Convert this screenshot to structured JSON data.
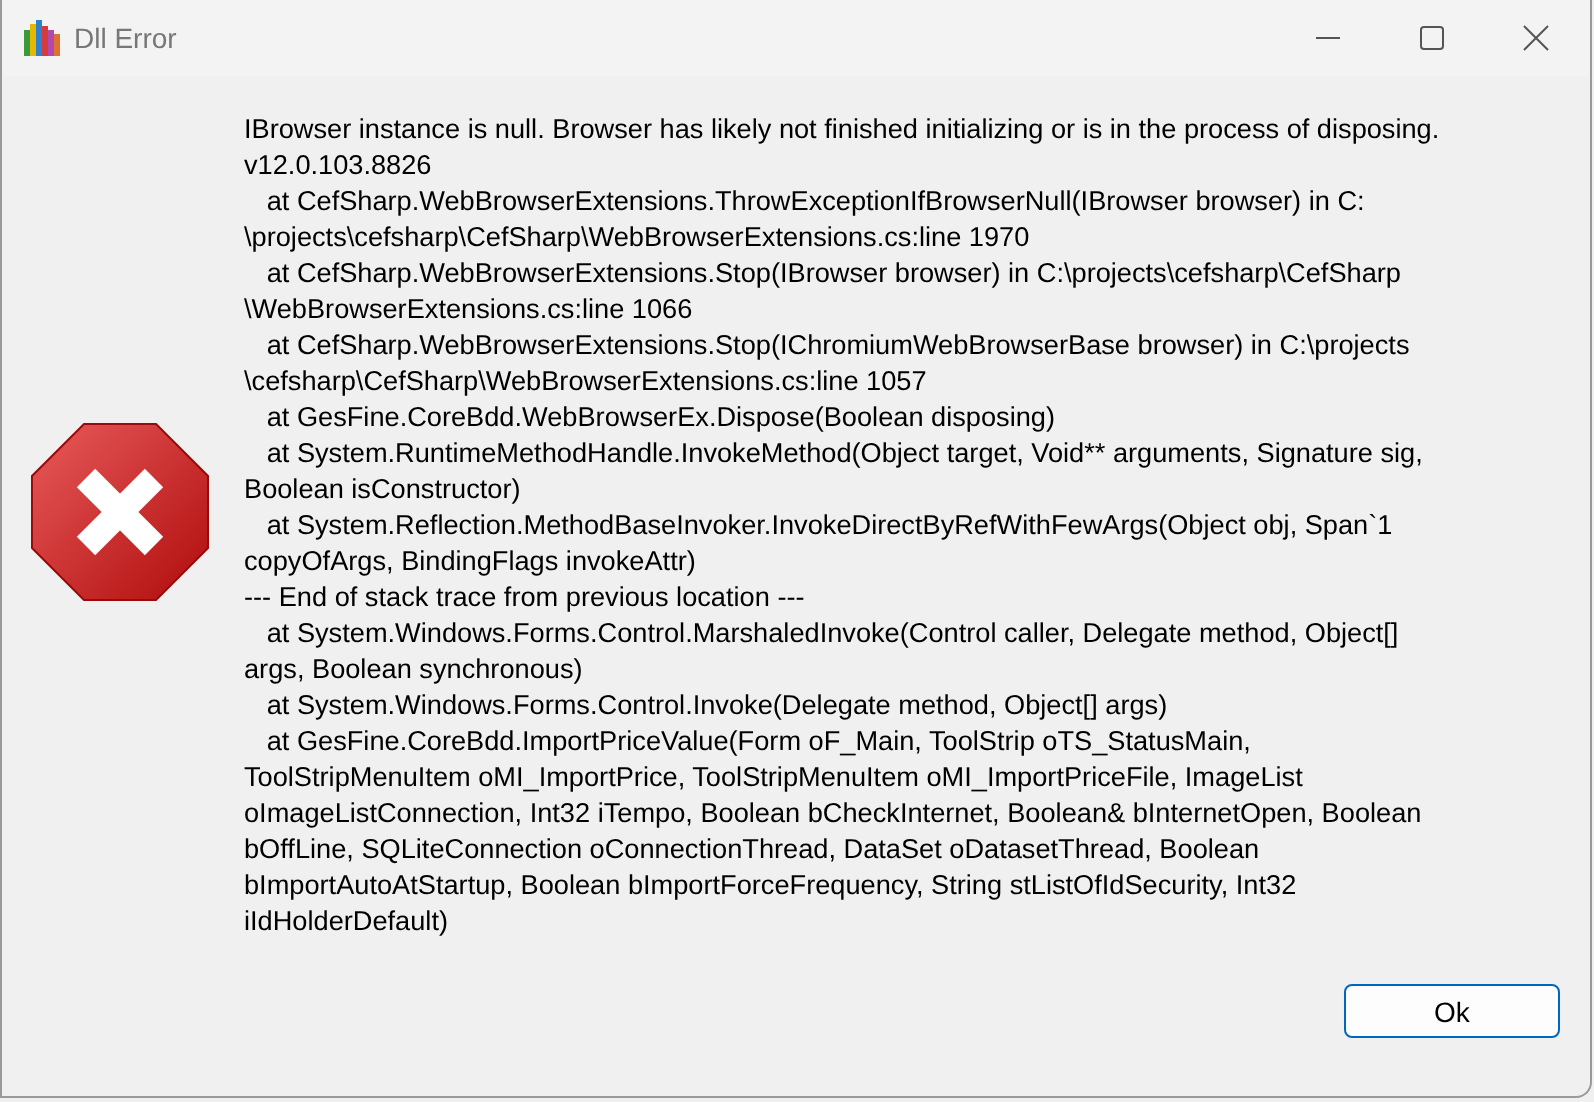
{
  "window": {
    "title": "Dll Error"
  },
  "message_lines": [
    "IBrowser instance is null. Browser has likely not finished initializing or is in the process of disposing.",
    "v12.0.103.8826",
    "   at CefSharp.WebBrowserExtensions.ThrowExceptionIfBrowserNull(IBrowser browser) in C:",
    "\\projects\\cefsharp\\CefSharp\\WebBrowserExtensions.cs:line 1970",
    "   at CefSharp.WebBrowserExtensions.Stop(IBrowser browser) in C:\\projects\\cefsharp\\CefSharp",
    "\\WebBrowserExtensions.cs:line 1066",
    "   at CefSharp.WebBrowserExtensions.Stop(IChromiumWebBrowserBase browser) in C:\\projects",
    "\\cefsharp\\CefSharp\\WebBrowserExtensions.cs:line 1057",
    "   at GesFine.CoreBdd.WebBrowserEx.Dispose(Boolean disposing)",
    "   at System.RuntimeMethodHandle.InvokeMethod(Object target, Void** arguments, Signature sig,",
    "Boolean isConstructor)",
    "   at System.Reflection.MethodBaseInvoker.InvokeDirectByRefWithFewArgs(Object obj, Span`1",
    "copyOfArgs, BindingFlags invokeAttr)",
    "--- End of stack trace from previous location ---",
    "   at System.Windows.Forms.Control.MarshaledInvoke(Control caller, Delegate method, Object[]",
    "args, Boolean synchronous)",
    "   at System.Windows.Forms.Control.Invoke(Delegate method, Object[] args)",
    "   at GesFine.CoreBdd.ImportPriceValue(Form oF_Main, ToolStrip oTS_StatusMain,",
    "ToolStripMenuItem oMI_ImportPrice, ToolStripMenuItem oMI_ImportPriceFile, ImageList",
    "oImageListConnection, Int32 iTempo, Boolean bCheckInternet, Boolean& bInternetOpen, Boolean",
    "bOffLine, SQLiteConnection oConnectionThread, DataSet oDatasetThread, Boolean",
    "bImportAutoAtStartup, Boolean bImportForceFrequency, String stListOfIdSecurity, Int32",
    "iIdHolderDefault)"
  ],
  "buttons": [
    {
      "label": "Ok"
    }
  ]
}
